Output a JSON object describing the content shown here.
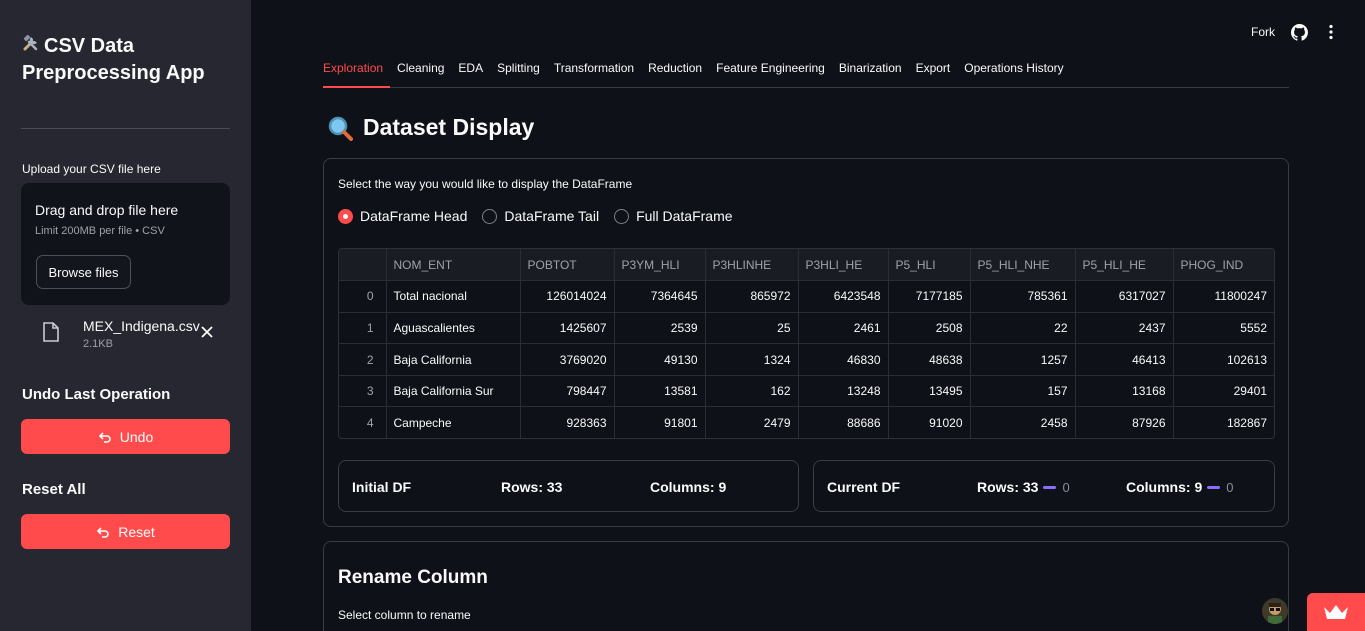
{
  "sidebar": {
    "title": "CSV Data Preprocessing App",
    "upload_label": "Upload your CSV file here",
    "dropzone_title": "Drag and drop file here",
    "dropzone_limit": "Limit 200MB per file • CSV",
    "browse_label": "Browse files",
    "file_name": "MEX_Indigena.csv",
    "file_size": "2.1KB",
    "undo_heading": "Undo Last Operation",
    "undo_label": "Undo",
    "reset_heading": "Reset All",
    "reset_label": "Reset"
  },
  "header": {
    "fork_label": "Fork"
  },
  "tabs": [
    {
      "label": "Exploration",
      "active": true
    },
    {
      "label": "Cleaning"
    },
    {
      "label": "EDA"
    },
    {
      "label": "Splitting"
    },
    {
      "label": "Transformation"
    },
    {
      "label": "Reduction"
    },
    {
      "label": "Feature Engineering"
    },
    {
      "label": "Binarization"
    },
    {
      "label": "Export"
    },
    {
      "label": "Operations History"
    }
  ],
  "main": {
    "title": "Dataset Display",
    "display_prompt": "Select the way you would like to display the DataFrame",
    "radio_options": [
      "DataFrame Head",
      "DataFrame Tail",
      "Full DataFrame"
    ],
    "radio_selected": "DataFrame Head",
    "table": {
      "columns": [
        "",
        "NOM_ENT",
        "POBTOT",
        "P3YM_HLI",
        "P3HLINHE",
        "P3HLI_HE",
        "P5_HLI",
        "P5_HLI_NHE",
        "P5_HLI_HE",
        "PHOG_IND"
      ],
      "rows": [
        [
          "0",
          "Total nacional",
          "126014024",
          "7364645",
          "865972",
          "6423548",
          "7177185",
          "785361",
          "6317027",
          "11800247"
        ],
        [
          "1",
          "Aguascalientes",
          "1425607",
          "2539",
          "25",
          "2461",
          "2508",
          "22",
          "2437",
          "5552"
        ],
        [
          "2",
          "Baja California",
          "3769020",
          "49130",
          "1324",
          "46830",
          "48638",
          "1257",
          "46413",
          "102613"
        ],
        [
          "3",
          "Baja California Sur",
          "798447",
          "13581",
          "162",
          "13248",
          "13495",
          "157",
          "13168",
          "29401"
        ],
        [
          "4",
          "Campeche",
          "928363",
          "91801",
          "2479",
          "88686",
          "91020",
          "2458",
          "87926",
          "182867"
        ]
      ]
    },
    "initial_df": {
      "title": "Initial DF",
      "rows": "Rows: 33",
      "columns": "Columns: 9"
    },
    "current_df": {
      "title": "Current DF",
      "rows": "Rows: 33",
      "rows_delta": "0",
      "columns": "Columns: 9",
      "columns_delta": "0"
    },
    "rename_title": "Rename Column",
    "rename_label": "Select column to rename"
  },
  "colors": {
    "accent": "#ff4b4b",
    "sidebar_bg": "#262730",
    "main_bg": "#0e1117",
    "delta": "#8a6dff"
  }
}
